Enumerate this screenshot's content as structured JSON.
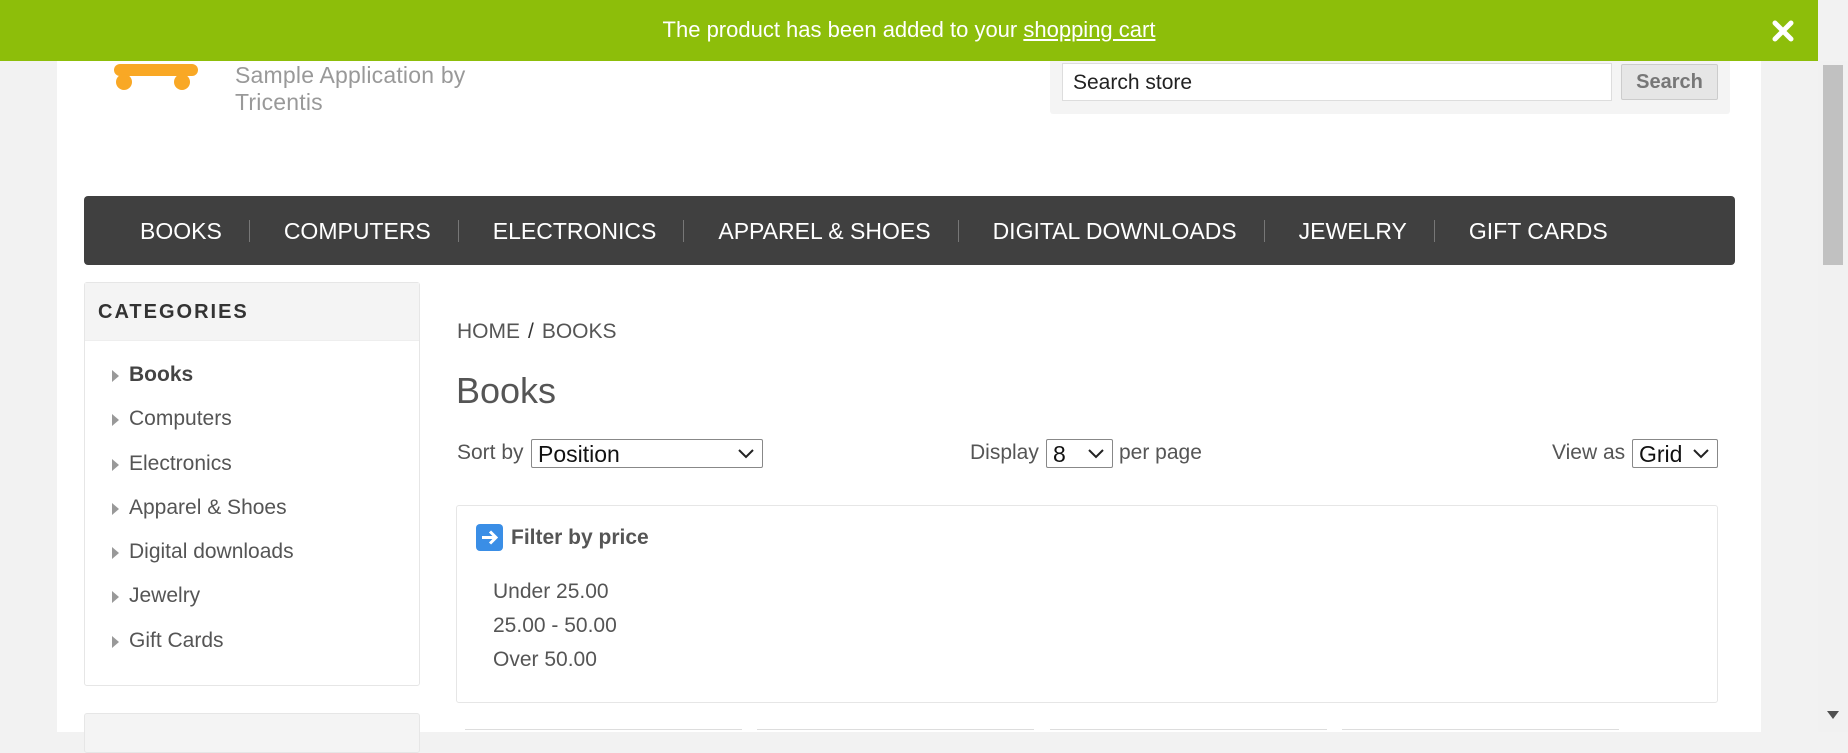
{
  "notification": {
    "text_before": "The product has been added to your ",
    "link_text": "shopping cart"
  },
  "header": {
    "tagline": "Sample Application by Tricentis",
    "search": {
      "placeholder": "Search store",
      "button_label": "Search"
    }
  },
  "top_menu": [
    "BOOKS",
    "COMPUTERS",
    "ELECTRONICS",
    "APPAREL & SHOES",
    "DIGITAL DOWNLOADS",
    "JEWELRY",
    "GIFT CARDS"
  ],
  "sidebar": {
    "title": "CATEGORIES",
    "items": [
      "Books",
      "Computers",
      "Electronics",
      "Apparel & Shoes",
      "Digital downloads",
      "Jewelry",
      "Gift Cards"
    ],
    "active_index": 0
  },
  "breadcrumb": {
    "home": "HOME",
    "separator": "/",
    "current": "BOOKS"
  },
  "page_title": "Books",
  "controls": {
    "sort_label": "Sort by",
    "sort_value": "Position",
    "display_label": "Display",
    "display_value": "8",
    "per_page_label": "per page",
    "view_as_label": "View as",
    "view_as_value": "Grid"
  },
  "filter": {
    "title": "Filter by price",
    "options": [
      "Under 25.00",
      "25.00 - 50.00",
      "Over 50.00"
    ]
  },
  "colors": {
    "notification_bg": "#8dbe0a",
    "menu_bg": "#404040",
    "logo_orange": "#f9a825",
    "filter_icon": "#3a8ee6"
  },
  "icons": [
    "close-icon",
    "logo-icon",
    "arrow-right-icon",
    "chevron-down-icon",
    "triangle-right-icon"
  ]
}
